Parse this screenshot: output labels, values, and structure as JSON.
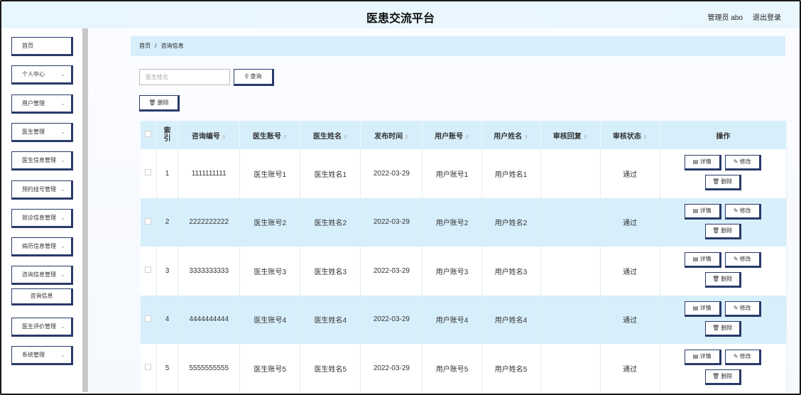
{
  "header": {
    "title": "医患交流平台",
    "user": "管理员 abo",
    "logout": "退出登录"
  },
  "sidebar": {
    "items": [
      {
        "label": "首页",
        "chevron": false
      },
      {
        "label": "个人中心",
        "chevron": true
      },
      {
        "label": "用户管理",
        "chevron": true
      },
      {
        "label": "医生管理",
        "chevron": true
      },
      {
        "label": "医生信息管理",
        "chevron": true
      },
      {
        "label": "预约挂号管理",
        "chevron": true
      },
      {
        "label": "就诊信息管理",
        "chevron": true
      },
      {
        "label": "病历信息管理",
        "chevron": true
      },
      {
        "label": "咨询信息管理",
        "chevron": true
      },
      {
        "label": "医生评价管理",
        "chevron": true
      },
      {
        "label": "系统管理",
        "chevron": true
      }
    ],
    "sub_item": "咨询信息"
  },
  "breadcrumb": {
    "home": "首页",
    "sep": "/",
    "current": "咨询信息"
  },
  "search": {
    "placeholder": "医生姓名",
    "button": "查询"
  },
  "toolbar": {
    "delete": "删除"
  },
  "table": {
    "columns": [
      "索引",
      "咨询编号",
      "医生账号",
      "医生姓名",
      "发布时间",
      "用户账号",
      "用户姓名",
      "审核回复",
      "审核状态",
      "操作"
    ],
    "rows": [
      {
        "index": "1",
        "code": "1111111111",
        "doctor_account": "医生账号1",
        "doctor_name": "医生姓名1",
        "time": "2022-03-29",
        "user_account": "用户账号1",
        "user_name": "用户姓名1",
        "reply": "",
        "status": "通过"
      },
      {
        "index": "2",
        "code": "2222222222",
        "doctor_account": "医生账号2",
        "doctor_name": "医生姓名2",
        "time": "2022-03-29",
        "user_account": "用户账号2",
        "user_name": "用户姓名2",
        "reply": "",
        "status": "通过"
      },
      {
        "index": "3",
        "code": "3333333333",
        "doctor_account": "医生账号3",
        "doctor_name": "医生姓名3",
        "time": "2022-03-29",
        "user_account": "用户账号3",
        "user_name": "用户姓名3",
        "reply": "",
        "status": "通过"
      },
      {
        "index": "4",
        "code": "4444444444",
        "doctor_account": "医生账号4",
        "doctor_name": "医生姓名4",
        "time": "2022-03-29",
        "user_account": "用户账号4",
        "user_name": "用户姓名4",
        "reply": "",
        "status": "通过"
      },
      {
        "index": "5",
        "code": "5555555555",
        "doctor_account": "医生账号5",
        "doctor_name": "医生姓名5",
        "time": "2022-03-29",
        "user_account": "用户账号5",
        "user_name": "用户姓名5",
        "reply": "",
        "status": "通过"
      }
    ],
    "actions": {
      "detail": "详情",
      "edit": "修改",
      "delete": "删除"
    }
  }
}
